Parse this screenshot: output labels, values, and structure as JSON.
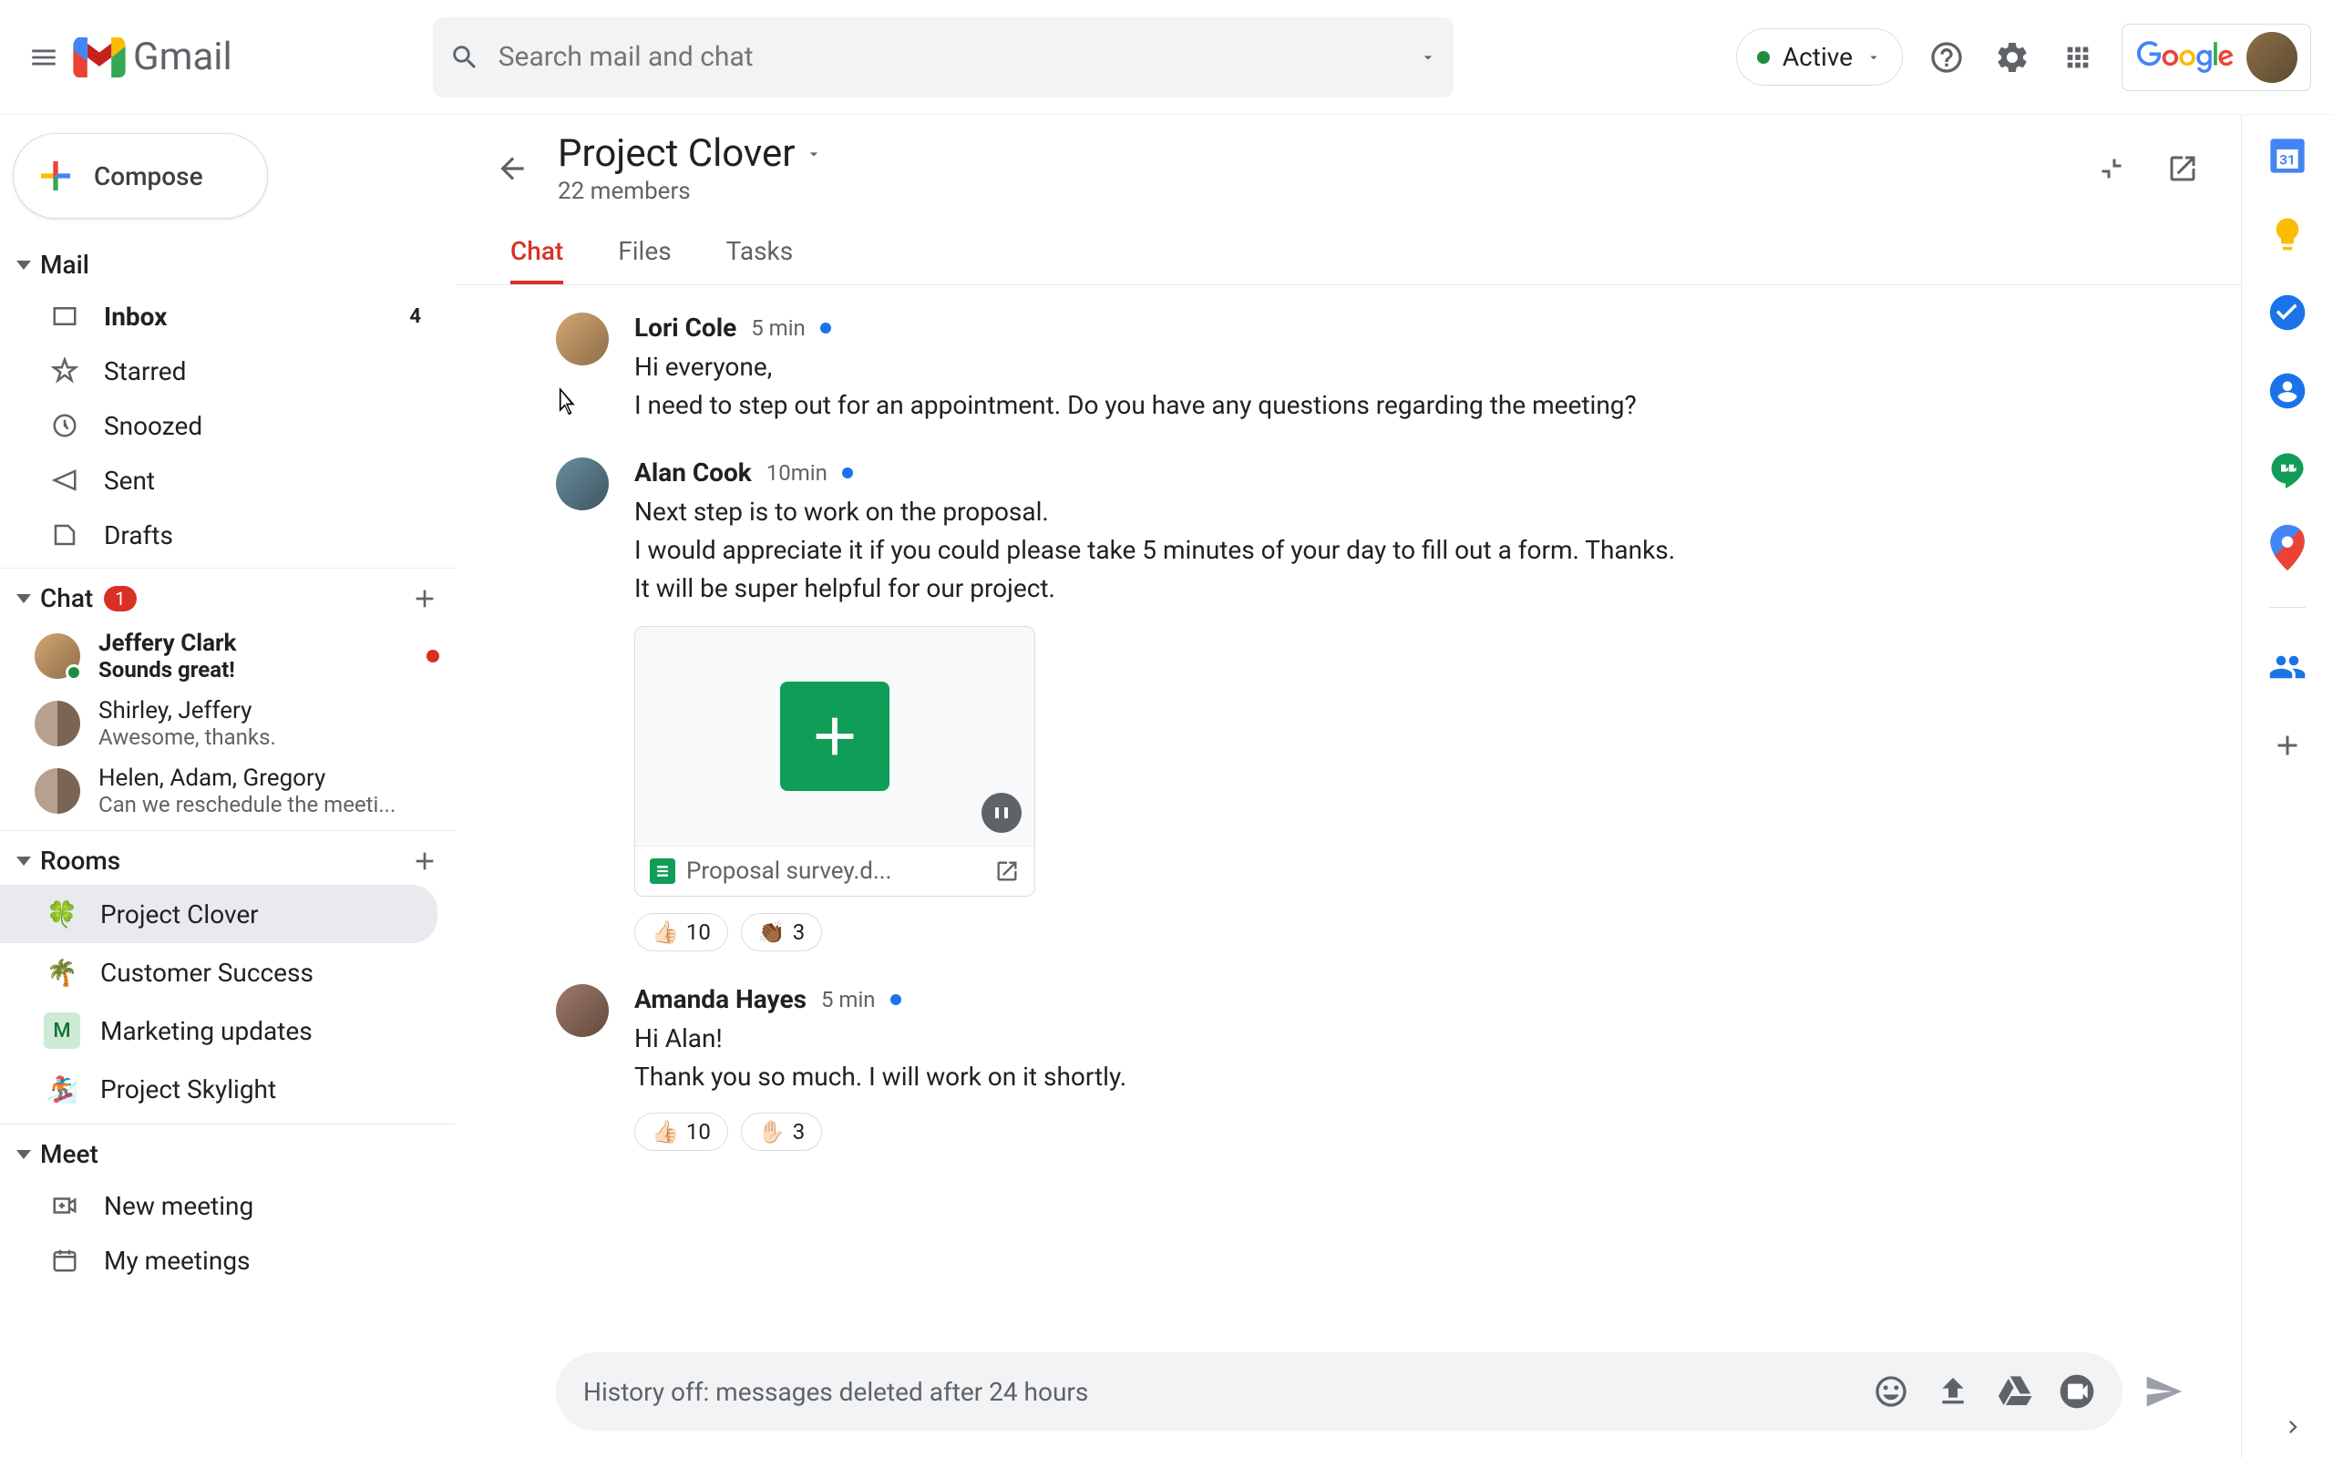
{
  "header": {
    "logo_text": "Gmail",
    "search_placeholder": "Search mail and chat",
    "active_status": "Active"
  },
  "compose_label": "Compose",
  "sections": {
    "mail": "Mail",
    "chat": "Chat",
    "rooms": "Rooms",
    "meet": "Meet"
  },
  "chat_badge": "1",
  "mail_items": [
    {
      "label": "Inbox",
      "count": "4",
      "bold": true
    },
    {
      "label": "Starred"
    },
    {
      "label": "Snoozed"
    },
    {
      "label": "Sent"
    },
    {
      "label": "Drafts"
    }
  ],
  "chat_items": [
    {
      "name": "Jeffery Clark",
      "preview": "Sounds great!",
      "bold": true,
      "unread": true,
      "presence": true
    },
    {
      "name": "Shirley, Jeffery",
      "preview": "Awesome, thanks.",
      "group": true
    },
    {
      "name": "Helen, Adam, Gregory",
      "preview": "Can we reschedule the meeti...",
      "group": true
    }
  ],
  "rooms_items": [
    {
      "label": "Project Clover",
      "emoji": "🍀",
      "active": true
    },
    {
      "label": "Customer Success",
      "emoji": "🌴"
    },
    {
      "label": "Marketing updates",
      "emoji": "M",
      "bg": "#ceead6"
    },
    {
      "label": "Project Skylight",
      "emoji": "🏂"
    }
  ],
  "meet_items": [
    {
      "label": "New meeting"
    },
    {
      "label": "My meetings"
    }
  ],
  "room": {
    "title": "Project Clover",
    "subtitle": "22 members",
    "tabs": [
      "Chat",
      "Files",
      "Tasks"
    ]
  },
  "messages": [
    {
      "author": "Lori Cole",
      "time": "5 min",
      "lines": [
        "Hi everyone,",
        "I need to step out for an appointment. Do you have any questions regarding the meeting?"
      ]
    },
    {
      "author": "Alan Cook",
      "time": "10min",
      "lines": [
        "Next step is to work on the proposal.",
        "I would appreciate it if you could please take 5 minutes of your day to fill out a form. Thanks.",
        "It will be super helpful for our project."
      ],
      "attachment": {
        "name": "Proposal survey.d..."
      },
      "reactions": [
        {
          "emoji": "👍🏻",
          "count": "10"
        },
        {
          "emoji": "👏🏾",
          "count": "3"
        }
      ]
    },
    {
      "author": "Amanda Hayes",
      "time": "5 min",
      "lines": [
        "Hi Alan!",
        "Thank you so much. I will work on it shortly."
      ],
      "reactions": [
        {
          "emoji": "👍🏻",
          "count": "10"
        },
        {
          "emoji": "✋🏻",
          "count": "3"
        }
      ]
    }
  ],
  "compose_placeholder": "History off: messages deleted after 24 hours"
}
